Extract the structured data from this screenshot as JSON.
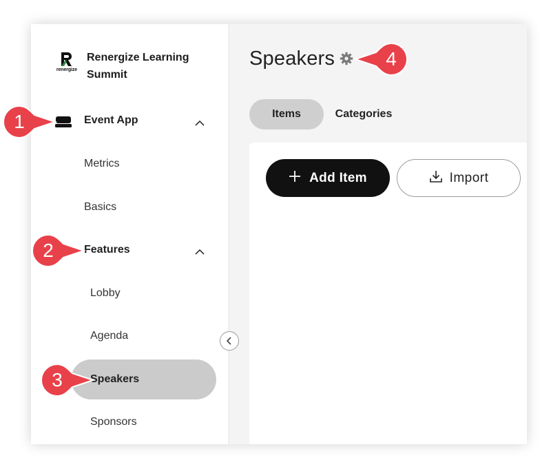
{
  "brand": {
    "name": "Renergize Learning Summit",
    "logo_text": "renergize"
  },
  "sidebar": {
    "event_app": "Event App",
    "metrics": "Metrics",
    "basics": "Basics",
    "features": "Features",
    "lobby": "Lobby",
    "agenda": "Agenda",
    "speakers": "Speakers",
    "sponsors": "Sponsors"
  },
  "main": {
    "title": "Speakers",
    "tabs": {
      "items": "Items",
      "categories": "Categories"
    },
    "add_item_label": "Add Item",
    "import_label": "Import"
  },
  "callouts": [
    "1",
    "2",
    "3",
    "4"
  ],
  "colors": {
    "callout_red": "#e8414a",
    "active_pill": "#cbcbcb",
    "primary_button": "#111111",
    "main_bg": "#f4f4f4"
  }
}
